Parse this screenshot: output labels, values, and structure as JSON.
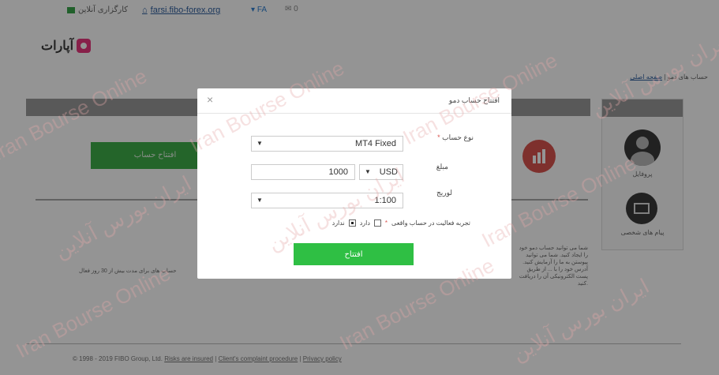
{
  "topbar": {
    "status_text": "کارگزاری آنلاین",
    "site_link": "farsi.fibo-forex.org",
    "lang": "FA",
    "messages_count": "0"
  },
  "logo": {
    "text": "آپارات"
  },
  "breadcrumb": {
    "link": "صفحه اصلی",
    "separator": "|",
    "current": "حساب های دمو"
  },
  "sidebar": {
    "profile_label": "پروفایل",
    "messages_label": "پیام های شخصی"
  },
  "background": {
    "open_account_label": "افتتاح حساب",
    "left_text": "حساب های برای مدت بیش از 30 روز فعال",
    "side_text": "شما می توانید حساب دمو خود را ایجاد کنید. شما می توانید پیوستن به ما را آزمایش کنید. آدرس خود را با ... از طریق پست الکترونیکی آن را دریافت کنید."
  },
  "dialog": {
    "title": "افتتاح حساب دمو",
    "account_type_label": "نوع حساب",
    "account_type_value": "MT4 Fixed",
    "amount_label": "مبلغ",
    "amount_value": "1000",
    "currency_value": "USD",
    "leverage_label": "لوریج",
    "leverage_value": "1:100",
    "experience_label": "تجربه فعالیت در حساب واقعی",
    "option_yes": "دارد",
    "option_no": "ندارد",
    "submit_label": "افتتاح"
  },
  "footer": {
    "copyright": "© 1998 - 2019 FIBO Group, Ltd.",
    "risks": "Risks are insured",
    "complaint": "Client's complaint procedure",
    "privacy": "Privacy policy",
    "sep": "|"
  },
  "watermark": {
    "en": "Iran Bourse Online",
    "fa": "ایران بورس آنلاین"
  },
  "colors": {
    "accent_green": "#2fbf44",
    "required": "#d9534f",
    "link": "#2f5f9f"
  }
}
